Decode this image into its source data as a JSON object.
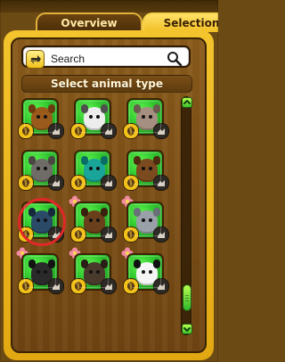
{
  "tabs": {
    "overview_label": "Overview",
    "selection_label": "Selection"
  },
  "search": {
    "placeholder": "Search"
  },
  "section": {
    "title": "Select animal type"
  },
  "colors": {
    "tile_green": "#2fc62e",
    "panel_gold": "#f3c42d",
    "selection_ring": "#e12828"
  },
  "animals": [
    {
      "icon": "wild-cat-icon",
      "face_color": "#9a5a1c",
      "ear_color": "#6d3b10",
      "flower": false,
      "selected": false
    },
    {
      "icon": "zebra-icon",
      "face_color": "#ededed",
      "ear_color": "#4f4f4f",
      "flower": false,
      "selected": false
    },
    {
      "icon": "ostrich-icon",
      "face_color": "#a48f80",
      "ear_color": "#6b5a4e",
      "flower": false,
      "selected": false
    },
    {
      "icon": "donkey-icon",
      "face_color": "#6f6b67",
      "ear_color": "#4b4743",
      "flower": false,
      "selected": false
    },
    {
      "icon": "chameleon-icon",
      "face_color": "#1aa59a",
      "ear_color": "#0b6e66",
      "flower": false,
      "selected": false
    },
    {
      "icon": "beaver-icon",
      "face_color": "#7c4a1f",
      "ear_color": "#4f2c10",
      "flower": false,
      "selected": false
    },
    {
      "icon": "penguin-icon",
      "face_color": "#2b4a68",
      "ear_color": "#16283b",
      "flower": false,
      "selected": true
    },
    {
      "icon": "monkey-icon",
      "face_color": "#6a3f1b",
      "ear_color": "#3a210d",
      "flower": true,
      "selected": false
    },
    {
      "icon": "elephant-icon",
      "face_color": "#9aa0a8",
      "ear_color": "#6a7078",
      "flower": true,
      "selected": false
    },
    {
      "icon": "boar-icon",
      "face_color": "#2a2a2a",
      "ear_color": "#141414",
      "flower": true,
      "selected": false
    },
    {
      "icon": "gorilla-icon",
      "face_color": "#4a3a2c",
      "ear_color": "#2a1f16",
      "flower": true,
      "selected": false
    },
    {
      "icon": "panda-icon",
      "face_color": "#f5f5f5",
      "ear_color": "#111111",
      "flower": true,
      "selected": false
    }
  ]
}
